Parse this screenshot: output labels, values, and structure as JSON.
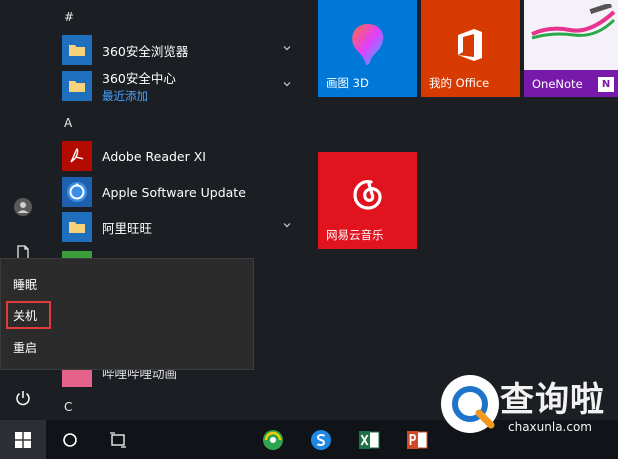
{
  "app_list": {
    "sections": [
      "#",
      "A",
      "C"
    ],
    "items": [
      {
        "name": "360安全浏览器",
        "sub": "",
        "icon": "folder-icon"
      },
      {
        "name": "360安全中心",
        "sub": "最近添加",
        "icon": "folder-icon"
      },
      {
        "name": "Adobe Reader XI",
        "sub": "",
        "icon": "adobe-reader-icon"
      },
      {
        "name": "Apple Software Update",
        "sub": "",
        "icon": "apple-update-icon"
      },
      {
        "name": "阿里旺旺",
        "sub": "",
        "icon": "folder-icon"
      },
      {
        "name": "哔哩哔哩动画",
        "sub": "",
        "icon": "bilibili-icon"
      }
    ]
  },
  "tiles": [
    {
      "label": "画图 3D",
      "color": "#0078d7",
      "icon": "paint3d-icon"
    },
    {
      "label": "我的 Office",
      "color": "#d83b01",
      "icon": "office-icon"
    },
    {
      "label": "OneNote",
      "color": "#7719aa",
      "icon": "onenote-icon"
    },
    {
      "label": "网易云音乐",
      "color": "#e0131f",
      "icon": "netease-music-icon"
    }
  ],
  "power_menu": {
    "items": [
      "睡眠",
      "关机",
      "重启"
    ],
    "highlighted": "关机",
    "highlight_color": "#e03a3a"
  },
  "rail": {
    "icons": [
      "user-avatar-icon",
      "document-icon",
      "power-icon"
    ]
  },
  "taskbar": {
    "icons": [
      "windows-start-icon",
      "cortana-search-icon",
      "task-view-icon",
      "360-browser-icon",
      "sogou-icon",
      "excel-icon",
      "powerpoint-icon"
    ]
  },
  "watermark": {
    "text": "查询啦",
    "url": "chaxunla.com"
  },
  "colors": {
    "background": "#1b1e22",
    "taskbar": "#101317",
    "accent_link": "#4aa3ff"
  }
}
